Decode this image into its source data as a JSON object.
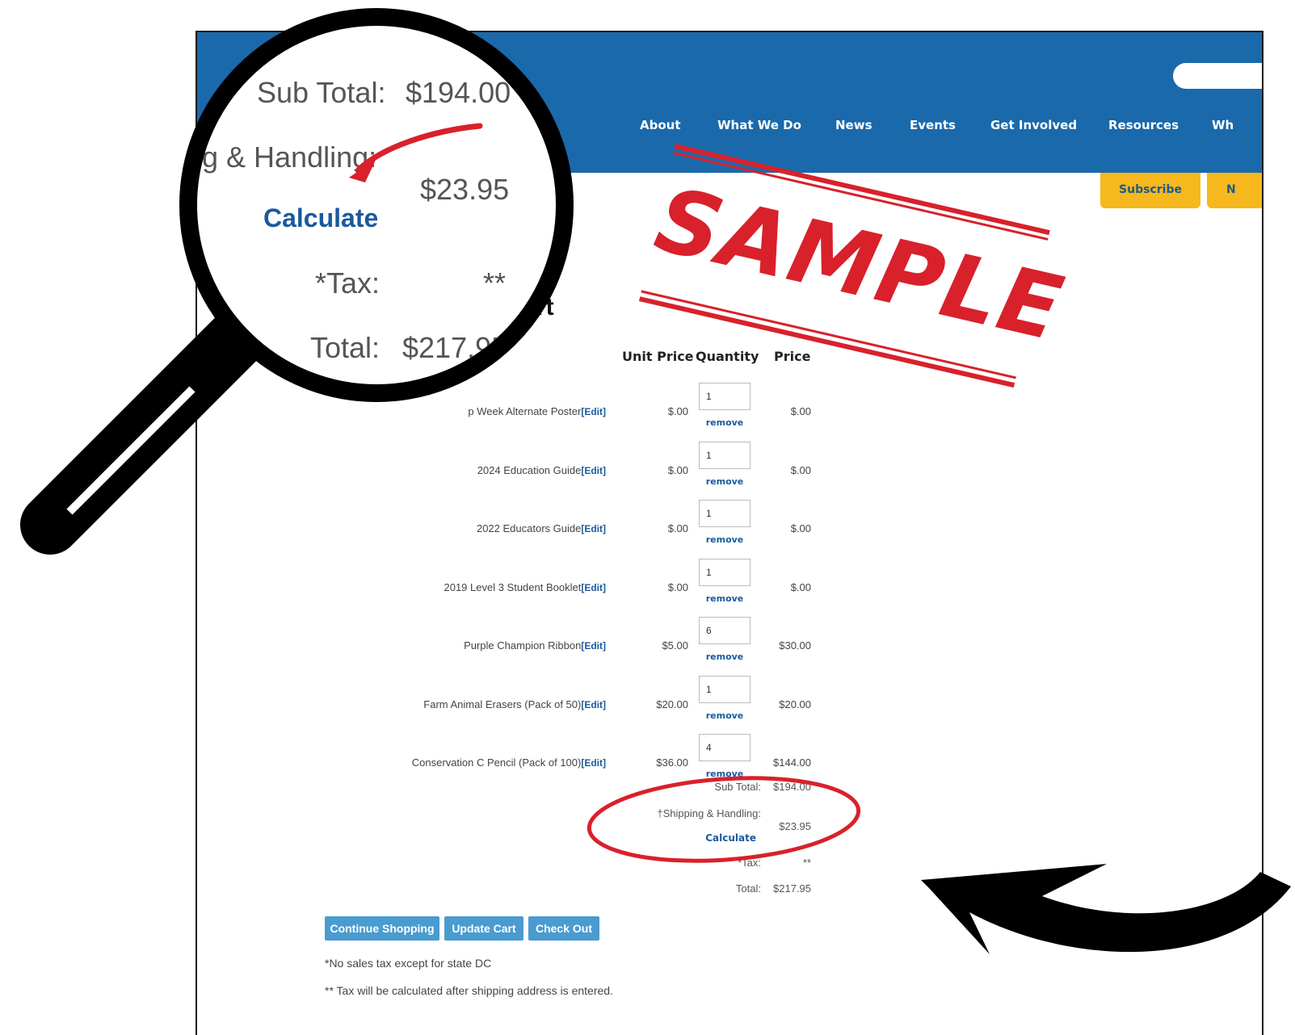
{
  "nav": {
    "items": [
      "About",
      "What We Do",
      "News",
      "Events",
      "Get Involved",
      "Resources",
      "Wh"
    ],
    "subscribe": "Subscribe",
    "second_button": "N"
  },
  "cart": {
    "heading": "rt",
    "columns": {
      "unit_price": "Unit Price",
      "quantity": "Quantity",
      "price": "Price"
    },
    "edit_label": "[Edit]",
    "remove_label": "remove",
    "items": [
      {
        "name": "p Week Alternate Poster",
        "unit": "$.00",
        "qty": "1",
        "price": "$.00"
      },
      {
        "name": "2024 Education Guide",
        "unit": "$.00",
        "qty": "1",
        "price": "$.00"
      },
      {
        "name": "2022 Educators Guide",
        "unit": "$.00",
        "qty": "1",
        "price": "$.00"
      },
      {
        "name": "2019 Level 3 Student Booklet",
        "unit": "$.00",
        "qty": "1",
        "price": "$.00"
      },
      {
        "name": "Purple Champion Ribbon",
        "unit": "$5.00",
        "qty": "6",
        "price": "$30.00"
      },
      {
        "name": "Farm Animal Erasers (Pack of 50)",
        "unit": "$20.00",
        "qty": "1",
        "price": "$20.00"
      },
      {
        "name": "Conservation C Pencil (Pack of 100)",
        "unit": "$36.00",
        "qty": "4",
        "price": "$144.00"
      }
    ],
    "totals": {
      "subtotal_label": "Sub Total:",
      "subtotal": "$194.00",
      "shipping_label": "†Shipping & Handling:",
      "shipping": "$23.95",
      "calculate": "Calculate",
      "tax_label": "*Tax:",
      "tax": "**",
      "total_label": "Total:",
      "total": "$217.95"
    },
    "buttons": {
      "continue": "Continue Shopping",
      "update": "Update Cart",
      "checkout": "Check Out"
    },
    "notes": [
      "*No sales tax except for state DC",
      "** Tax will be calculated after shipping address is entered."
    ]
  },
  "stamp": {
    "text": "SAMPLE",
    "color": "#d8212b"
  },
  "magnifier": {
    "subtotal_label": "Sub Total:",
    "subtotal": "$194.00",
    "shipping_label": "g & Handling:",
    "shipping": "$23.95",
    "calculate": "Calculate",
    "tax_label": "*Tax:",
    "tax": "**",
    "total_label": "Total:",
    "total": "$217.95"
  },
  "colors": {
    "header_blue": "#1a69aa",
    "accent_yellow": "#f6b81c",
    "button_blue": "#4a9bd0",
    "highlight_red": "#d8212b"
  }
}
